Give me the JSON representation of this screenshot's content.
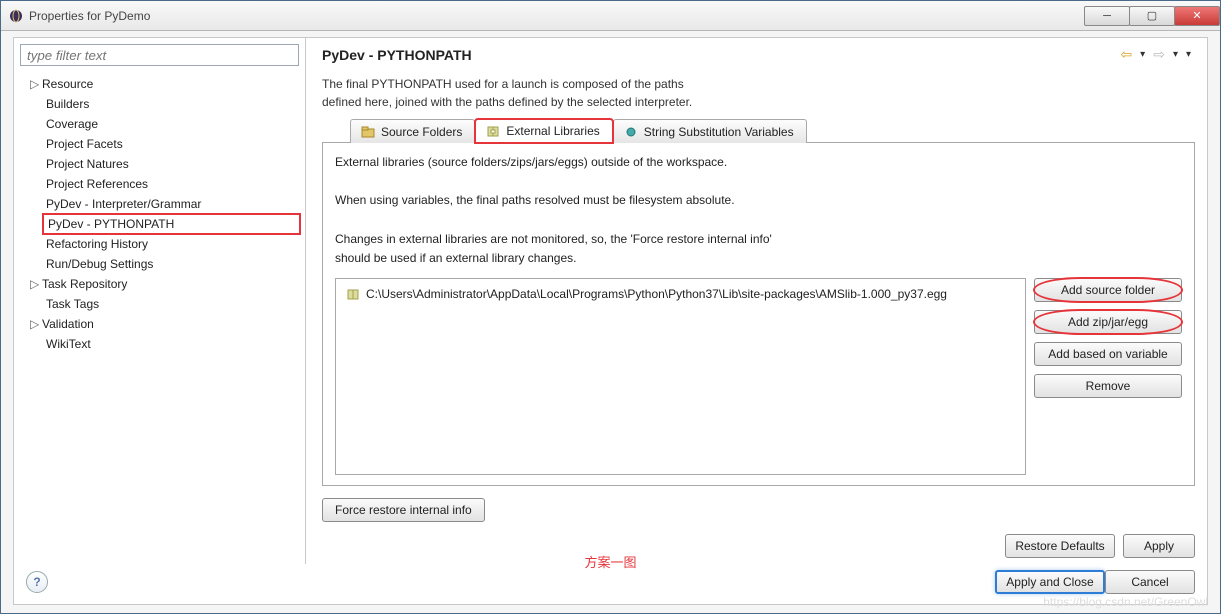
{
  "titlebar": {
    "title": "Properties for PyDemo"
  },
  "leftpane": {
    "filter_placeholder": "type filter text",
    "items": [
      {
        "label": "Resource",
        "expandable": true
      },
      {
        "label": "Builders"
      },
      {
        "label": "Coverage"
      },
      {
        "label": "Project Facets"
      },
      {
        "label": "Project Natures"
      },
      {
        "label": "Project References"
      },
      {
        "label": "PyDev - Interpreter/Grammar"
      },
      {
        "label": "PyDev - PYTHONPATH",
        "selected": true
      },
      {
        "label": "Refactoring History"
      },
      {
        "label": "Run/Debug Settings"
      },
      {
        "label": "Task Repository",
        "expandable": true
      },
      {
        "label": "Task Tags"
      },
      {
        "label": "Validation",
        "expandable": true
      },
      {
        "label": "WikiText"
      }
    ]
  },
  "header": {
    "title": "PyDev - PYTHONPATH"
  },
  "description": {
    "line1": "The final PYTHONPATH used for a launch is composed of the paths",
    "line2": "defined here, joined with the paths defined by the selected interpreter."
  },
  "tabs": {
    "source": "Source Folders",
    "external": "External Libraries",
    "stringsub": "String Substitution Variables"
  },
  "external_tab": {
    "line1": "External libraries (source folders/zips/jars/eggs) outside of the workspace.",
    "line2": "When using variables, the final paths resolved must be filesystem absolute.",
    "line3": "Changes in external libraries are not monitored, so, the 'Force restore internal info'",
    "line4": "should be used if an external library changes.",
    "entry": "C:\\Users\\Administrator\\AppData\\Local\\Programs\\Python\\Python37\\Lib\\site-packages\\AMSlib-1.000_py37.egg",
    "buttons": {
      "add_folder": "Add source folder",
      "add_zip": "Add zip/jar/egg",
      "add_var": "Add based on variable",
      "remove": "Remove"
    },
    "force_restore": "Force restore internal info"
  },
  "bottom": {
    "restore": "Restore Defaults",
    "apply": "Apply"
  },
  "dialog": {
    "apply_close": "Apply and Close",
    "cancel": "Cancel"
  },
  "caption": "方案一图",
  "watermark": "https://blog.csdn.net/GreenOwl"
}
